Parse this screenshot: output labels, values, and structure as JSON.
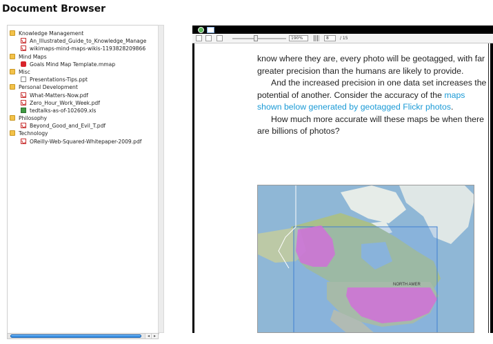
{
  "app": {
    "title": "Document Browser"
  },
  "tree": [
    {
      "type": "folder",
      "label": "Knowledge Management",
      "icon": "folder-icon"
    },
    {
      "type": "pdf",
      "label": "An_Illustrated_Guide_to_Knowledge_Manage",
      "icon": "pdf-icon"
    },
    {
      "type": "pdf",
      "label": "wikimaps-mind-maps-wikis-1193828209866",
      "icon": "pdf-icon"
    },
    {
      "type": "folder",
      "label": "Mind Maps",
      "icon": "folder-icon"
    },
    {
      "type": "mmap",
      "label": "Goals Mind Map Template.mmap",
      "icon": "mindmap-file-icon"
    },
    {
      "type": "folder",
      "label": "Misc",
      "icon": "folder-icon"
    },
    {
      "type": "ppt",
      "label": "Presentations-Tips.ppt",
      "icon": "document-icon"
    },
    {
      "type": "folder",
      "label": "Personal Development",
      "icon": "folder-icon"
    },
    {
      "type": "pdf",
      "label": "What-Matters-Now.pdf",
      "icon": "pdf-icon"
    },
    {
      "type": "pdf",
      "label": "Zero_Hour_Work_Week.pdf",
      "icon": "pdf-icon"
    },
    {
      "type": "xls",
      "label": "tedtalks-as-of-102609.xls",
      "icon": "spreadsheet-icon"
    },
    {
      "type": "folder",
      "label": "Philosophy",
      "icon": "folder-icon"
    },
    {
      "type": "pdf",
      "label": "Beyond_Good_and_Evil_T.pdf",
      "icon": "pdf-icon"
    },
    {
      "type": "folder",
      "label": "Technology",
      "icon": "folder-icon"
    },
    {
      "type": "pdf",
      "label": "OReilly-Web-Squared-Whitepaper-2009.pdf",
      "icon": "pdf-icon"
    }
  ],
  "viewer": {
    "zoom": "190%",
    "page": "8",
    "page_total": "/ 15",
    "scroll_left_glyph": "◂",
    "scroll_right_glyph": "▸"
  },
  "document": {
    "p1": "know where they are, every photo will be geotagged, with far greater precision than the humans are likely to provide.",
    "p2_start": "And the increased precision in one data set increases the potential of another. Consider the accuracy of the ",
    "p2_link": "maps shown below generated by geotagged Flickr photos",
    "p2_end": ".",
    "p3": "How much more accurate will these maps be when there are billions of photos?",
    "right_column_letters": [
      "c",
      "a",
      "t",
      "r",
      "c",
      "v",
      "i"
    ],
    "map_label": "NORTH AMER"
  },
  "colors": {
    "link": "#1a9ad6",
    "map_overlay": "#d070d8",
    "map_water": "#8fb7d6",
    "scroll_thumb": "#1d79d6"
  }
}
